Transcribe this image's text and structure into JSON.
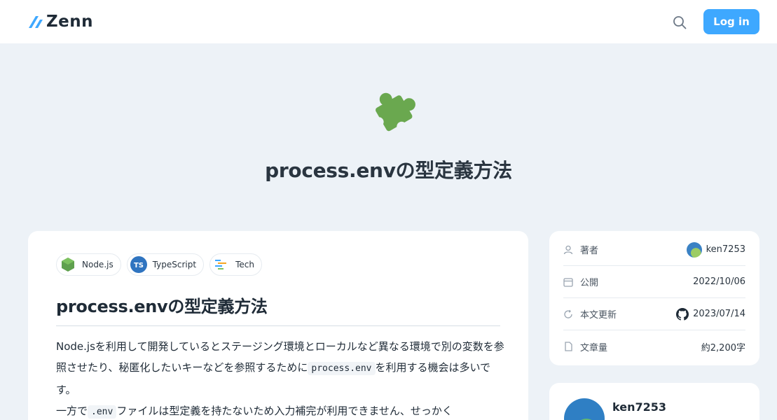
{
  "header": {
    "logo_text": "Zenn",
    "login_label": "Log in",
    "brand_color": "#3ea8ff"
  },
  "hero": {
    "emoji": "puzzle-piece",
    "title": "process.envの型定義方法"
  },
  "article": {
    "topics": [
      {
        "label": "Node.js",
        "icon": "nodejs-icon"
      },
      {
        "label": "TypeScript",
        "icon": "typescript-icon"
      },
      {
        "label": "Tech",
        "icon": "tech-icon"
      }
    ],
    "title": "process.envの型定義方法",
    "paragraph1_a": "Node.jsを利用して開発しているとステージング環境とローカルなど異なる環境で別の変数を参照させたり、秘匿化したいキーなどを参照するために",
    "paragraph1_code": "process.env",
    "paragraph1_b": "を利用する機会は多いです。",
    "paragraph2_a": "一方で",
    "paragraph2_code": ".env",
    "paragraph2_b": "ファイルは型定義を持たないため入力補完が利用できません、せっかく"
  },
  "info": {
    "author_label": "著者",
    "author_value": "ken7253",
    "published_label": "公開",
    "published_value": "2022/10/06",
    "updated_label": "本文更新",
    "updated_value": "2023/07/14",
    "length_label": "文章量",
    "length_value": "約2,200字"
  },
  "author_card": {
    "name": "ken7253"
  }
}
